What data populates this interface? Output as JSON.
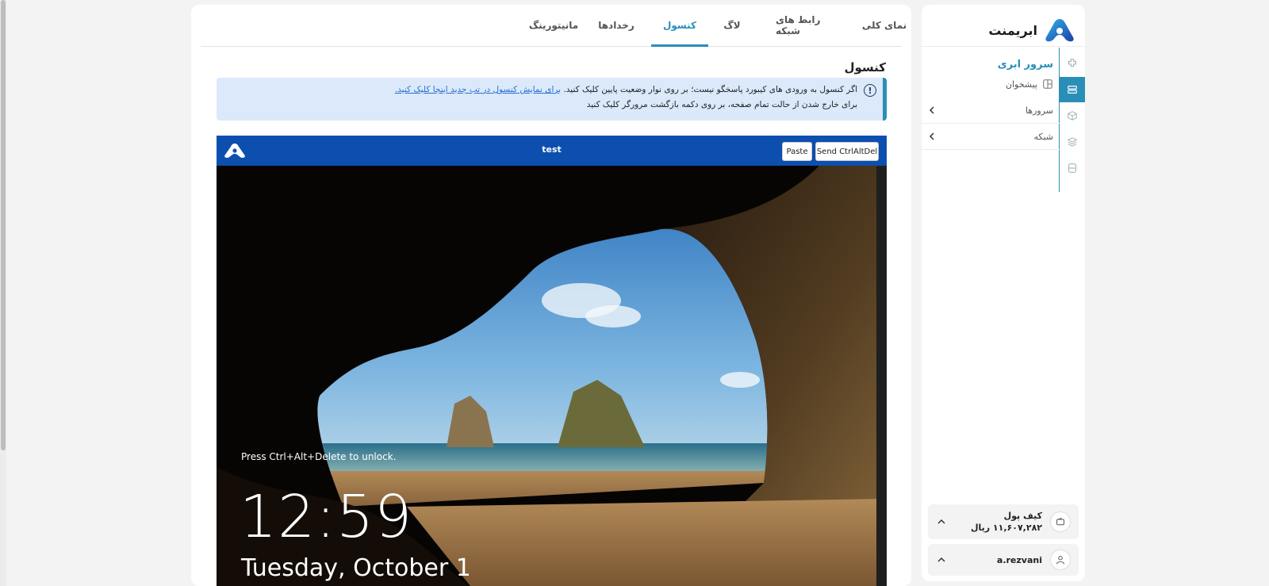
{
  "app": {
    "brand_name": "ابریمنت"
  },
  "sidebar": {
    "section_title": "سرور ابری",
    "dashboard_label": "پیشخوان",
    "items": [
      {
        "label": "سرورها"
      },
      {
        "label": "شبکه"
      }
    ],
    "wallet": {
      "title": "کیف پول",
      "amount": "۱۱,۶۰۷,۲۸۲ ریال"
    },
    "user": {
      "username": "a.rezvani"
    }
  },
  "tabs": [
    {
      "label": "نمای کلی",
      "active": false
    },
    {
      "label": "رابط های شبکه",
      "active": false
    },
    {
      "label": "لاگ",
      "active": false
    },
    {
      "label": "کنسول",
      "active": true
    },
    {
      "label": "رخدادها",
      "active": false
    },
    {
      "label": "مانیتورینگ",
      "active": false
    }
  ],
  "console_section": {
    "title": "کنسول",
    "alert": {
      "line1_text": "اگر کنسول به ورودی های کیبورد پاسخگو نیست؛ بر روی نوار وضعیت پایین کلیک کنید.",
      "line1_link": "برای نمایش کنسول در تب جدید اینجا کلیک کنید.",
      "line2_text": "برای خارج شدن از حالت تمام صفحه، بر روی دکمه بازگشت مرورگر کلیک کنید"
    },
    "toolbar": {
      "vm_name": "test",
      "paste_label": "Paste",
      "ctrlaltdel_label": "Send CtrlAltDel"
    },
    "lock_screen": {
      "unlock_hint": "Press Ctrl+Alt+Delete to unlock.",
      "time": "12:59",
      "date": "Tuesday, October 1"
    }
  },
  "colors": {
    "accent": "#2a8fb8",
    "console_bar": "#0d4fae",
    "alert_bg": "#dbe9fb"
  }
}
